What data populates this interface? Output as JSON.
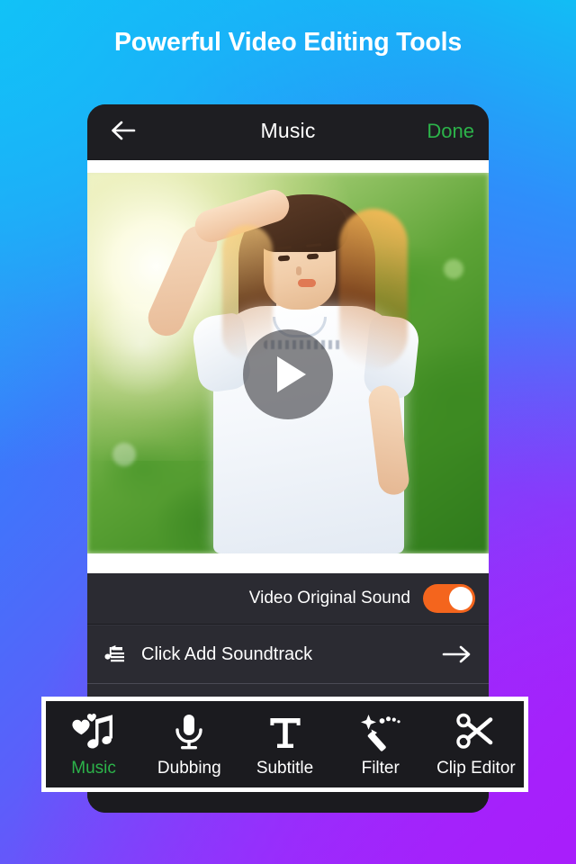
{
  "headline": "Powerful Video Editing Tools",
  "colors": {
    "accent_green": "#2CB34A",
    "toggle_on": "#F4651D",
    "panel_dark": "#2B2B32",
    "frame_dark": "#1D1D21",
    "bg_cyan": "#12BDF5",
    "bg_blue": "#5B5FFA",
    "bg_purple": "#A81EFB",
    "highlight_border": "#FFFFFF"
  },
  "appbar": {
    "back_icon": "arrow-left-icon",
    "title": "Music",
    "done_label": "Done"
  },
  "player": {
    "play_icon": "play-icon",
    "state": "paused"
  },
  "rows": {
    "original_sound": {
      "label": "Video Original Sound",
      "toggle_state": "on"
    },
    "add_soundtrack": {
      "icon": "music-sheet-icon",
      "label": "Click Add Soundtrack",
      "arrow_icon": "arrow-right-icon"
    }
  },
  "toolbar": {
    "items": [
      {
        "label": "Music",
        "icon": "music-hearts-icon",
        "active": true
      },
      {
        "label": "Dubbing",
        "icon": "microphone-icon",
        "active": false
      },
      {
        "label": "Subtitle",
        "icon": "text-t-icon",
        "active": false
      },
      {
        "label": "Filter",
        "icon": "magic-wand-icon",
        "active": false
      },
      {
        "label": "Clip Editor",
        "icon": "scissors-icon",
        "active": false
      }
    ]
  }
}
